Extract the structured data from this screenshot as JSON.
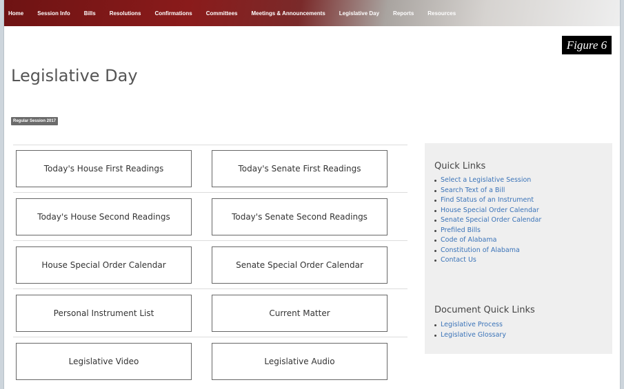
{
  "nav": {
    "items": [
      "Home",
      "Session Info",
      "Bills",
      "Resolutions",
      "Confirmations",
      "Committees",
      "Meetings & Announcements",
      "Legislative Day",
      "Reports",
      "Resources"
    ]
  },
  "figure_label": "Figure 6",
  "page_title": "Legislative Day",
  "session_badge": "Regular Session 2017",
  "buttons": [
    "Today's House First Readings",
    "Today's Senate First Readings",
    "Today's House Second Readings",
    "Today's Senate Second Readings",
    "House Special Order Calendar",
    "Senate Special Order Calendar",
    "Personal Instrument List",
    "Current Matter",
    "Legislative Video",
    "Legislative Audio"
  ],
  "quick_links": {
    "title": "Quick Links",
    "items": [
      "Select a Legislative Session",
      "Search Text of a Bill",
      "Find Status of an Instrument",
      "House Special Order Calendar",
      "Senate Special Order Calendar",
      "Prefiled Bills",
      "Code of Alabama",
      "Constitution of Alabama",
      "Contact Us"
    ]
  },
  "document_quick_links": {
    "title": "Document Quick Links",
    "items": [
      "Legislative Process",
      "Legislative Glossary"
    ]
  },
  "colors": {
    "nav_start": "#6e1313",
    "link": "#3a73b8",
    "panel_bg": "#efefef",
    "badge_bg": "#6b6b6b"
  }
}
